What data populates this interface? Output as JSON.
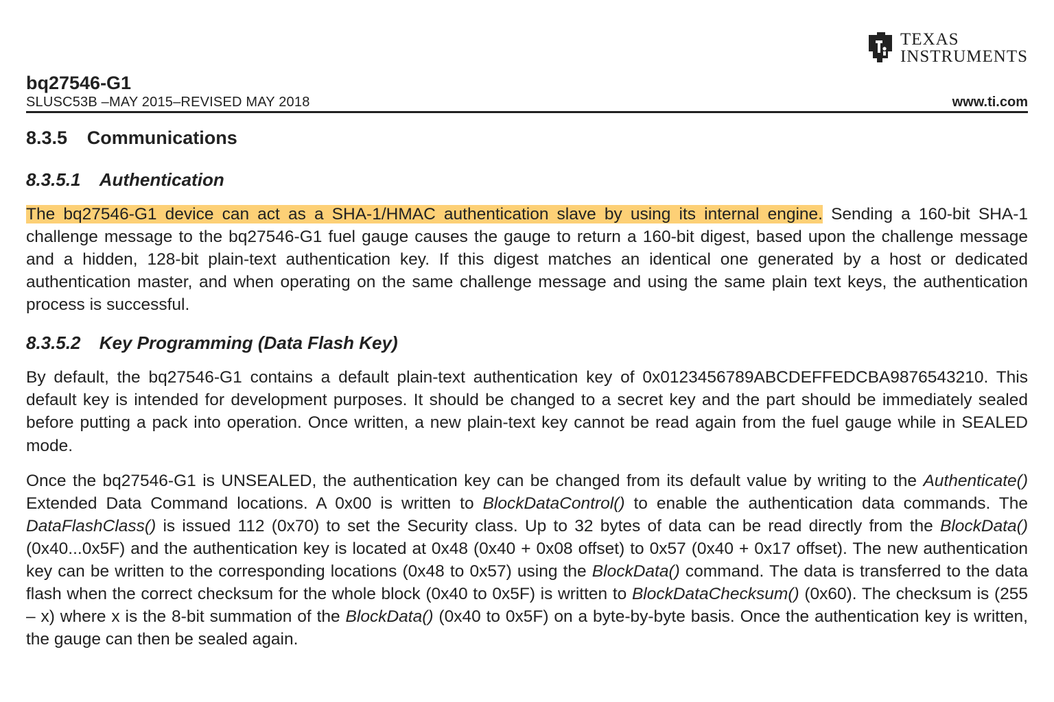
{
  "header": {
    "brand_line1": "TEXAS",
    "brand_line2": "INSTRUMENTS",
    "part_number": "bq27546-G1",
    "doc_rev": "SLUSC53B –MAY 2015–REVISED MAY 2018",
    "website": "www.ti.com"
  },
  "section": {
    "number": "8.3.5",
    "title": "Communications"
  },
  "sub1": {
    "number": "8.3.5.1",
    "title": "Authentication",
    "para_highlight": "The bq27546-G1 device can act as a SHA-1/HMAC authentication slave by using its internal engine.",
    "para_rest": " Sending a 160-bit SHA-1 challenge message to the bq27546-G1 fuel gauge causes the gauge to return a 160-bit digest, based upon the challenge message and a hidden, 128-bit plain-text authentication key. If this digest matches an identical one generated by a host or dedicated authentication master, and when operating on the same challenge message and using the same plain text keys, the authentication process is successful."
  },
  "sub2": {
    "number": "8.3.5.2",
    "title": "Key Programming (Data Flash Key)",
    "p1": "By default, the bq27546-G1 contains a default plain-text authentication key of 0x0123456789ABCDEFFEDCBA9876543210. This default key is intended for development purposes. It should be changed to a secret key and the part should be immediately sealed before putting a pack into operation. Once written, a new plain-text key cannot be read again from the fuel gauge while in SEALED mode.",
    "p2a": "Once the bq27546-G1 is UNSEALED, the authentication key can be changed from its default value by writing to the ",
    "p2b": "Authenticate()",
    "p2c": " Extended Data Command locations. A 0x00 is written to ",
    "p2d": "BlockDataControl()",
    "p2e": " to enable the authentication data commands. The ",
    "p2f": "DataFlashClass()",
    "p2g": " is issued 112 (0x70) to set the Security class. Up to 32 bytes of data can be read directly from the ",
    "p2h": "BlockData()",
    "p2i": " (0x40...0x5F) and the authentication key is located at 0x48 (0x40 + 0x08 offset) to 0x57 (0x40 + 0x17 offset). The new authentication key can be written to the corresponding locations (0x48 to 0x57) using the ",
    "p2j": "BlockData()",
    "p2k": " command. The data is transferred to the data flash when the correct checksum for the whole block (0x40 to 0x5F) is written to ",
    "p2l": "BlockDataChecksum()",
    "p2m": " (0x60). The checksum is (255 – x) where x is the 8-bit summation of the ",
    "p2n": "BlockData()",
    "p2o": " (0x40 to 0x5F) on a byte-by-byte basis. Once the authentication key is written, the gauge can then be sealed again."
  }
}
